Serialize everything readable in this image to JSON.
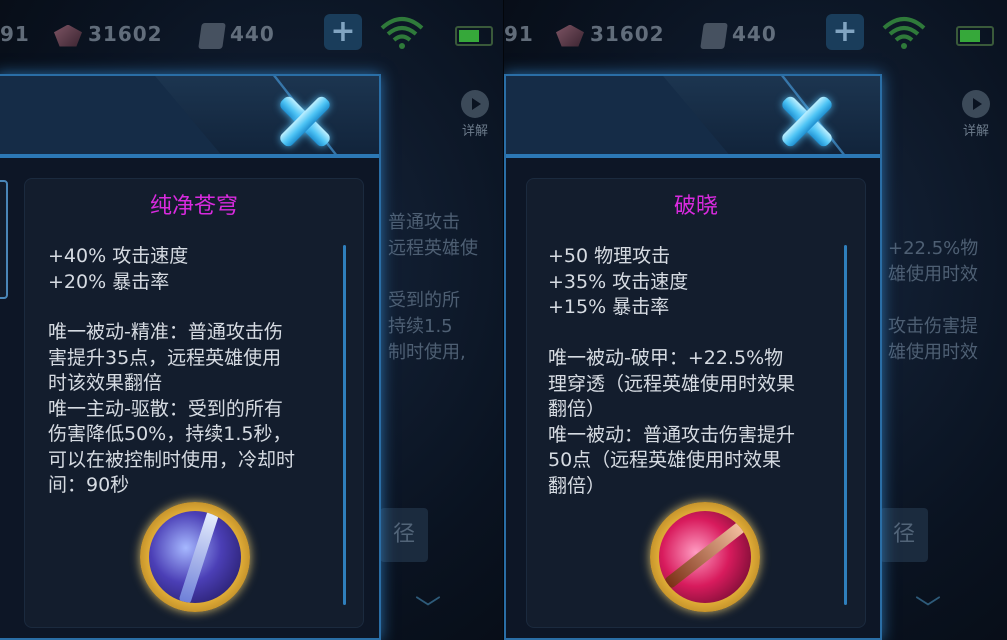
{
  "status_bar": {
    "partial_number": "91",
    "diamonds": "31602",
    "coupons": "440",
    "add_button": "+"
  },
  "background": {
    "left_snippet_1": "普通攻击",
    "left_snippet_2": "远程英雄使",
    "left_snippet_3": "受到的所",
    "left_snippet_4": "持续1.5",
    "left_snippet_5": "制时使用,",
    "right_snippet_1": "+22.5%物",
    "right_snippet_2": "雄使用时效",
    "right_snippet_3": "攻击伤害提",
    "right_snippet_4": "雄使用时效",
    "detail_label": "详解",
    "path_label": "径"
  },
  "panels": [
    {
      "item_name": "纯净苍穹",
      "stats": "+40% 攻击速度\n+20% 暴击率",
      "passive": "唯一被动-精准：普通攻击伤\n害提升35点，远程英雄使用\n时该效果翻倍\n唯一主动-驱散：受到的所有\n伤害降低50%，持续1.5秒，\n可以在被控制时使用，冷却时\n间：90秒",
      "icon": "purity-sky-blade-icon"
    },
    {
      "item_name": "破晓",
      "stats": "+50 物理攻击\n+35% 攻击速度\n+15% 暴击率",
      "passive": "唯一被动-破甲：+22.5%物\n理穿透（远程英雄使用时效果\n翻倍）\n唯一被动：普通攻击伤害提升\n50点（远程英雄使用时效果\n翻倍）",
      "icon": "daybreak-crossbow-icon"
    }
  ],
  "colors": {
    "item_name": "#d92adf",
    "panel_border": "#2a6ea6",
    "close_icon": "#4ec4f5"
  }
}
